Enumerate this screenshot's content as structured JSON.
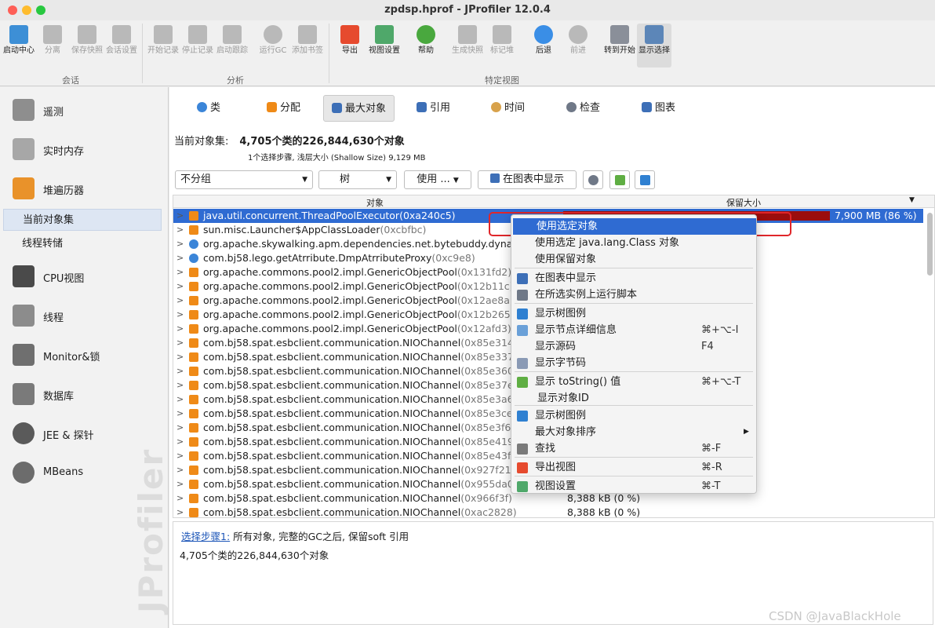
{
  "window": {
    "title": "zpdsp.hprof - JProfiler 12.0.4"
  },
  "toolbar": {
    "buttons": [
      {
        "label": "启动中心",
        "enabled": true,
        "icon": "launch-center-icon"
      },
      {
        "label": "分离",
        "enabled": false,
        "icon": "detach-icon"
      },
      {
        "label": "保存快照",
        "enabled": false,
        "icon": "save-snapshot-icon"
      },
      {
        "label": "会话设置",
        "enabled": false,
        "icon": "session-settings-icon"
      },
      {
        "label": "开始记录",
        "enabled": false,
        "icon": "start-recording-icon"
      },
      {
        "label": "停止记录",
        "enabled": false,
        "icon": "stop-recording-icon"
      },
      {
        "label": "启动跟踪",
        "enabled": false,
        "icon": "start-tracking-icon"
      },
      {
        "label": "运行GC",
        "enabled": false,
        "icon": "run-gc-icon"
      },
      {
        "label": "添加书签",
        "enabled": false,
        "icon": "add-bookmark-icon"
      },
      {
        "label": "导出",
        "enabled": true,
        "icon": "export-icon"
      },
      {
        "label": "视图设置",
        "enabled": true,
        "icon": "view-settings-icon"
      },
      {
        "label": "帮助",
        "enabled": true,
        "icon": "help-icon"
      },
      {
        "label": "生成快照",
        "enabled": false,
        "icon": "snapshot-icon"
      },
      {
        "label": "标记堆",
        "enabled": false,
        "icon": "mark-heap-icon"
      },
      {
        "label": "后退",
        "enabled": true,
        "icon": "back-icon"
      },
      {
        "label": "前进",
        "enabled": false,
        "icon": "forward-icon"
      },
      {
        "label": "转到开始",
        "enabled": true,
        "icon": "home-icon"
      },
      {
        "label": "显示选择",
        "enabled": true,
        "icon": "show-selection-icon"
      }
    ],
    "groups": {
      "session": "会话",
      "analysis": "分析",
      "view_specific": "特定视图"
    }
  },
  "sidebar": {
    "items": [
      {
        "label": "遥测",
        "icon": "telemetry-icon"
      },
      {
        "label": "实时内存",
        "icon": "live-memory-icon"
      },
      {
        "label": "堆遍历器",
        "icon": "heap-walker-icon"
      }
    ],
    "subitems": [
      {
        "label": "当前对象集",
        "selected": true
      },
      {
        "label": "线程转储",
        "selected": false
      }
    ],
    "items2": [
      {
        "label": "CPU视图",
        "icon": "cpu-icon"
      },
      {
        "label": "线程",
        "icon": "threads-icon"
      },
      {
        "label": "Monitor&锁",
        "icon": "lock-icon"
      },
      {
        "label": "数据库",
        "icon": "database-icon"
      },
      {
        "label": "JEE & 探针",
        "icon": "probe-icon"
      },
      {
        "label": "MBeans",
        "icon": "globe-icon"
      }
    ],
    "watermark": "JProfiler"
  },
  "tabs": [
    {
      "label": "类",
      "selected": false,
      "icon": "class-icon"
    },
    {
      "label": "分配",
      "selected": false,
      "icon": "allocation-icon"
    },
    {
      "label": "最大对象",
      "selected": true,
      "icon": "biggest-objects-icon"
    },
    {
      "label": "引用",
      "selected": false,
      "icon": "references-icon"
    },
    {
      "label": "时间",
      "selected": false,
      "icon": "time-icon"
    },
    {
      "label": "检查",
      "selected": false,
      "icon": "inspect-icon"
    },
    {
      "label": "图表",
      "selected": false,
      "icon": "graph-icon"
    }
  ],
  "objectset": {
    "label": "当前对象集:",
    "summary": "4,705个类的226,844,630个对象",
    "detail": "1个选择步骤, 浅层大小 (Shallow Size) 9,129 MB"
  },
  "controls": {
    "grouping": "不分组",
    "view_mode": "树",
    "use_button": "使用 ...",
    "show_in_graph": "在图表中显示"
  },
  "table": {
    "columns": [
      "对象",
      "保留大小"
    ],
    "rows": [
      {
        "name": "java.util.concurrent.ThreadPoolExecutor",
        "id": "(0xa240c5)",
        "size": "7,900 MB (86 %)",
        "selected": true,
        "kind": "object"
      },
      {
        "name": "sun.misc.Launcher$AppClassLoader",
        "id": "(0xcbfbc)",
        "size": "",
        "kind": "object"
      },
      {
        "name": "org.apache.skywalking.apm.dependencies.net.bytebuddy.dynam",
        "id": "",
        "size": "",
        "kind": "class"
      },
      {
        "name": "com.bj58.lego.getAtrribute.DmpAtrributeProxy",
        "id": "(0xc9e8)",
        "size": "",
        "kind": "class"
      },
      {
        "name": "org.apache.commons.pool2.impl.GenericObjectPool",
        "id": "(0x131fd2)",
        "size": "",
        "kind": "object"
      },
      {
        "name": "org.apache.commons.pool2.impl.GenericObjectPool",
        "id": "(0x12b11c)",
        "size": "",
        "kind": "object"
      },
      {
        "name": "org.apache.commons.pool2.impl.GenericObjectPool",
        "id": "(0x12ae8a)",
        "size": "",
        "kind": "object"
      },
      {
        "name": "org.apache.commons.pool2.impl.GenericObjectPool",
        "id": "(0x12b265)",
        "size": "",
        "kind": "object"
      },
      {
        "name": "org.apache.commons.pool2.impl.GenericObjectPool",
        "id": "(0x12afd3)",
        "size": "",
        "kind": "object"
      },
      {
        "name": "com.bj58.spat.esbclient.communication.NIOChannel",
        "id": "(0x85e314)",
        "size": "",
        "kind": "object"
      },
      {
        "name": "com.bj58.spat.esbclient.communication.NIOChannel",
        "id": "(0x85e337)",
        "size": "",
        "kind": "object"
      },
      {
        "name": "com.bj58.spat.esbclient.communication.NIOChannel",
        "id": "(0x85e360)",
        "size": "",
        "kind": "object"
      },
      {
        "name": "com.bj58.spat.esbclient.communication.NIOChannel",
        "id": "(0x85e37e)",
        "size": "",
        "kind": "object"
      },
      {
        "name": "com.bj58.spat.esbclient.communication.NIOChannel",
        "id": "(0x85e3a6)",
        "size": "",
        "kind": "object"
      },
      {
        "name": "com.bj58.spat.esbclient.communication.NIOChannel",
        "id": "(0x85e3ce)",
        "size": "",
        "kind": "object"
      },
      {
        "name": "com.bj58.spat.esbclient.communication.NIOChannel",
        "id": "(0x85e3f6)",
        "size": "",
        "kind": "object"
      },
      {
        "name": "com.bj58.spat.esbclient.communication.NIOChannel",
        "id": "(0x85e419)",
        "size": "",
        "kind": "object"
      },
      {
        "name": "com.bj58.spat.esbclient.communication.NIOChannel",
        "id": "(0x85e43f)",
        "size": "",
        "kind": "object"
      },
      {
        "name": "com.bj58.spat.esbclient.communication.NIOChannel",
        "id": "(0x927f21)",
        "size": "",
        "kind": "object"
      },
      {
        "name": "com.bj58.spat.esbclient.communication.NIOChannel",
        "id": "(0x955da0)",
        "size": "",
        "kind": "object"
      },
      {
        "name": "com.bj58.spat.esbclient.communication.NIOChannel",
        "id": "(0x966f3f)",
        "size": "8,388 kB (0 %)",
        "kind": "object"
      },
      {
        "name": "com.bj58.spat.esbclient.communication.NIOChannel",
        "id": "(0xac2828)",
        "size": "8,388 kB (0 %)",
        "kind": "object"
      }
    ]
  },
  "context_menu": {
    "items": [
      {
        "label": "使用选定对象",
        "shortcut": "",
        "highlighted": true,
        "icon": ""
      },
      {
        "label": "使用选定 java.lang.Class 对象",
        "shortcut": "",
        "icon": ""
      },
      {
        "label": "使用保留对象",
        "shortcut": "",
        "icon": ""
      },
      {
        "label": "在图表中显示",
        "shortcut": "",
        "icon": "graph-icon"
      },
      {
        "label": "在所选实例上运行脚本",
        "shortcut": "",
        "icon": "gear-icon"
      },
      {
        "label": "显示树图例",
        "shortcut": "",
        "icon": "info-icon"
      },
      {
        "label": "显示节点详细信息",
        "shortcut": "⌘+⌥-I",
        "icon": "magnifier-icon"
      },
      {
        "label": "显示源码",
        "shortcut": "F4",
        "icon": ""
      },
      {
        "label": "显示字节码",
        "shortcut": "",
        "icon": "bytecode-icon"
      },
      {
        "label": "显示 toString() 值",
        "shortcut": "⌘+⌥-T",
        "icon": "tostring-icon"
      },
      {
        "label": "显示对象ID",
        "shortcut": "",
        "icon": ""
      },
      {
        "label": "显示树图例",
        "shortcut": "",
        "icon": "info-icon"
      },
      {
        "label": "最大对象排序",
        "shortcut": "",
        "submenu": true,
        "icon": ""
      },
      {
        "label": "查找",
        "shortcut": "⌘-F",
        "icon": "search-icon"
      },
      {
        "label": "导出视图",
        "shortcut": "⌘-R",
        "icon": "export-icon"
      },
      {
        "label": "视图设置",
        "shortcut": "⌘-T",
        "icon": "view-settings-icon"
      }
    ]
  },
  "status": {
    "step_link": "选择步骤1:",
    "step_text": "所有对象, 完整的GC之后, 保留soft 引用",
    "summary": "4,705个类的226,844,630个对象"
  },
  "footer_watermark": "CSDN @JavaBlackHole",
  "colors": {
    "selection": "#2f6bd2",
    "retained_bar": "#9b0d0d",
    "highlight_box": "#e0262a",
    "object_icon": "#ef8a17"
  }
}
